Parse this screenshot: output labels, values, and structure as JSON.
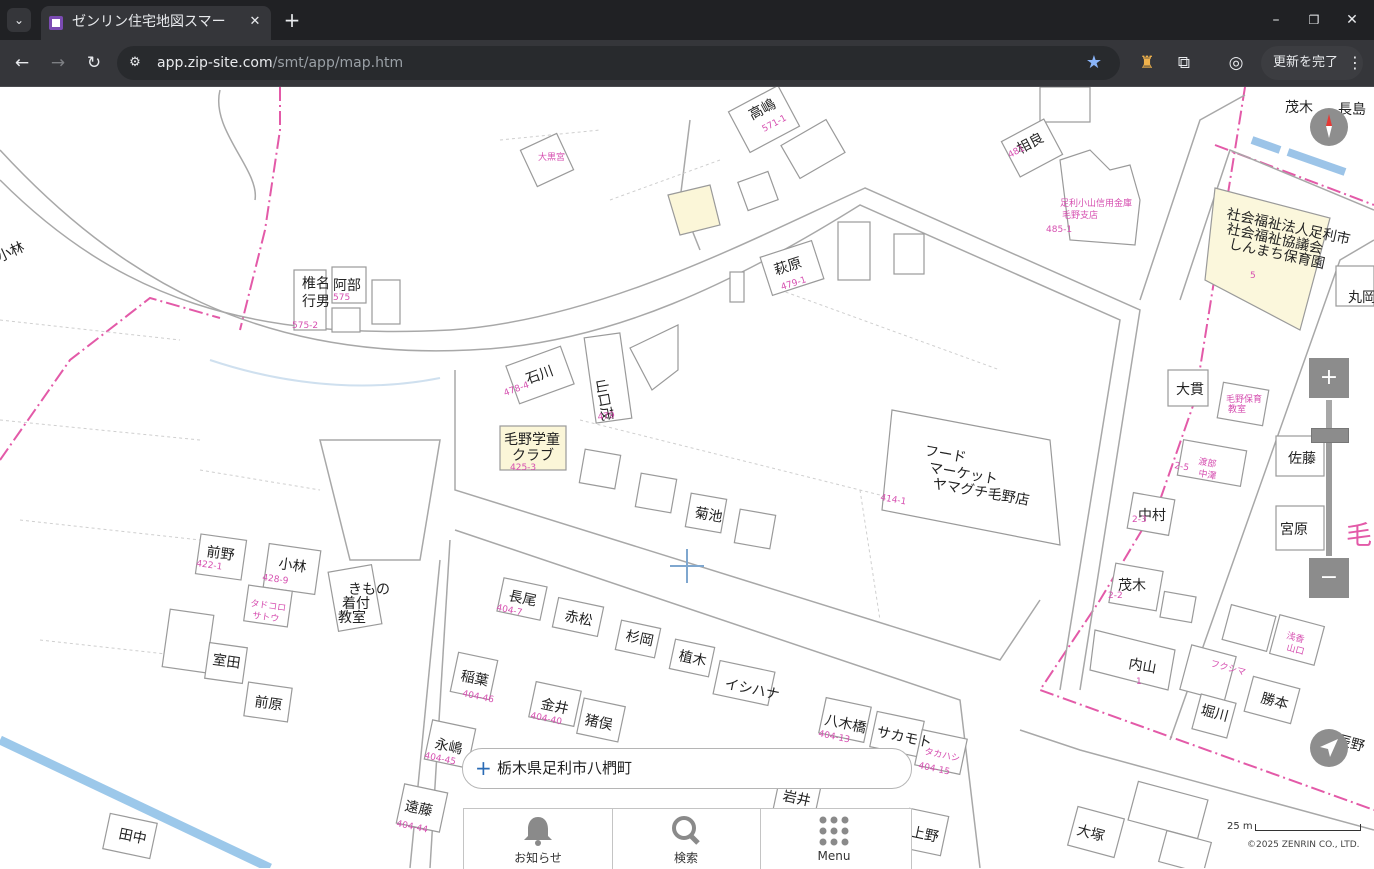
{
  "browser": {
    "tab_title": "ゼンリン住宅地図スマー",
    "url_host": "app.zip-site.com",
    "url_path": "/smt/app/map.htm",
    "update_button": "更新を完了"
  },
  "map": {
    "search_text": "栃木県足利市八椚町",
    "scale_label": "25 m",
    "copyright": "©2025 ZENRIN CO., LTD.",
    "menu": [
      {
        "label": "お知らせ",
        "icon": "bell-icon"
      },
      {
        "label": "検索",
        "icon": "search-icon"
      },
      {
        "label": "Menu",
        "icon": "grid-icon"
      }
    ],
    "labels": {
      "takashima": "高嶋",
      "takashima_no": "571-1",
      "aibara": "相良",
      "aibara_no": "481",
      "ashikaga_bank": "足利小山信用金庫",
      "ashikaga_bank2": "毛野支店",
      "ashikaga_bank_no": "485-1",
      "shigeki": "茂木",
      "nagashima": "長島",
      "oomi": "大黒宮",
      "shiina": "椎名",
      "shiina2": "行男",
      "shiina_no": "575-2",
      "abe": "阿部",
      "abe_no": "575",
      "kobayashi_w": "小林",
      "hagiwara": "萩原",
      "hagiwara_no": "479-1",
      "ishikawa": "石川",
      "ishikawa_no": "478-4",
      "yamaguchi": "山口茂",
      "yamaguchi_no": "479",
      "keno_club": "毛野学童",
      "keno_club2": "クラブ",
      "keno_club_no": "425-3",
      "food": "フード",
      "food2": "マーケット",
      "food3": "ヤマグチ毛野店",
      "food_no": "414-1",
      "kikuchi": "菊池",
      "welfare1": "社会福祉法人足利市",
      "welfare2": "社会福祉協議会",
      "welfare3": "しんまち保育園",
      "welfare_no": "5",
      "maruoka": "丸岡",
      "oonuki": "大貫",
      "mano": "毛野保育",
      "mano2": "教室",
      "watanabe": "渡部",
      "watanabe2": "中澤",
      "watanabe_no": "2-5",
      "saho": "佐藤",
      "nakamura": "中村",
      "nakamura_no": "2-3",
      "miyahara": "宮原",
      "mogi2": "茂木",
      "mogi2_no": "2-2",
      "uchiyama": "内山",
      "uchiyama_no": "1",
      "maeno": "前野",
      "maeno_no": "422-1",
      "kobayashi": "小林",
      "kobayashi_no": "428-9",
      "kimono": "きもの",
      "kimono2": "着付",
      "kimono3": "教室",
      "tadokoro": "タドコロ",
      "tadokoro2": "サトウ",
      "muroto": "室田",
      "maehara": "前原",
      "nagao": "長尾",
      "nagao_no": "404-7",
      "akamatsu": "赤松",
      "sugita": "杉岡",
      "ueki": "植木",
      "ishihana": "イシハナ",
      "inaba": "稲葉",
      "inaba_no": "404-46",
      "kanai": "金井",
      "kanai_no": "404-40",
      "inomata": "猪俣",
      "nagashima2": "永嶋",
      "nagashima2_no": "404-45",
      "yagihashi": "八木橋",
      "yagihashi_no": "404-13",
      "sakamoto": "サカモト",
      "takahashi": "タカハシ",
      "takahashi_no": "404-15",
      "endo": "遠藤",
      "endo_no": "404-44",
      "tanaka": "田中",
      "iwai": "岩井",
      "ueno": "上野",
      "oozuka": "大塚",
      "fukushima": "フクシマ",
      "katsumoto": "勝本",
      "horikawa": "堀川",
      "asaka": "浅香",
      "asaka2": "山口",
      "kaiji": "辰野",
      "taka": "毛"
    }
  }
}
